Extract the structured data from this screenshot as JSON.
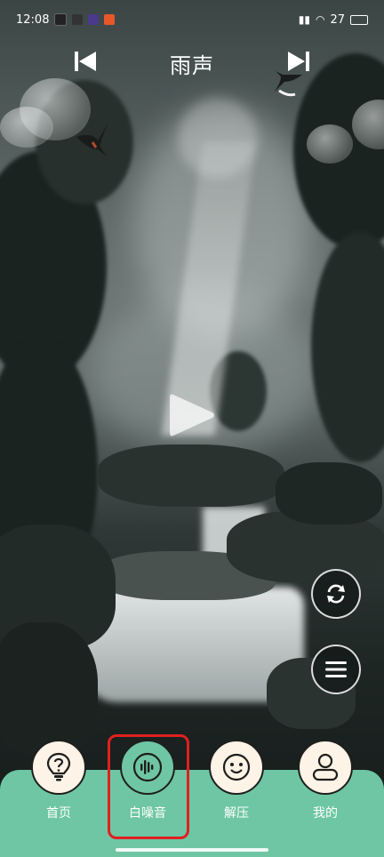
{
  "status_bar": {
    "time": "12:08",
    "battery": "27"
  },
  "header": {
    "title": "雨声"
  },
  "tabs": [
    {
      "label": "首页",
      "icon": "lightbulb-question-icon"
    },
    {
      "label": "白噪音",
      "icon": "sound-wave-icon",
      "active": true
    },
    {
      "label": "解压",
      "icon": "smiley-face-icon"
    },
    {
      "label": "我的",
      "icon": "user-profile-icon"
    }
  ],
  "colors": {
    "tab_bar": "#6ec6a4",
    "tab_circle": "#fdf3e6",
    "highlight": "#e02020"
  }
}
